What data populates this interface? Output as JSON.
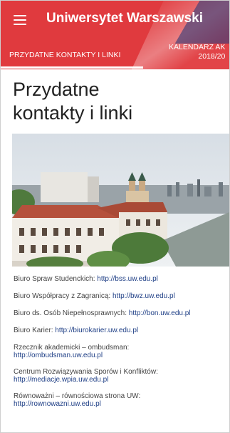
{
  "app": {
    "title": "Uniwersytet Warszawski"
  },
  "tabs": [
    {
      "label": "PRZYDATNE KONTAKTY I LINKI",
      "active": true
    },
    {
      "label_line1": "KALENDARZ AK",
      "label_line2": "2018/20",
      "active": false
    }
  ],
  "page": {
    "heading_line1": "Przydatne",
    "heading_line2": "kontakty i linki"
  },
  "links": [
    {
      "label": "Biuro Spraw Studenckich:",
      "url": "http://bss.uw.edu.pl"
    },
    {
      "label": "Biuro Współpracy z Zagranicą:",
      "url": "http://bwz.uw.edu.pl"
    },
    {
      "label": "Biuro ds. Osób Niepełnosprawnych:",
      "url": "http://bon.uw.edu.pl"
    },
    {
      "label": "Biuro Karier:",
      "url": "http://biurokarier.uw.edu.pl"
    },
    {
      "label": "Rzecznik akademicki – ombudsman:",
      "url": "http://ombudsman.uw.edu.pl"
    },
    {
      "label": "Centrum Rozwiązywania Sporów i Konfliktów:",
      "url": "http://mediacje.wpia.uw.edu.pl"
    },
    {
      "label": "Równoważni – równościowa strona UW:",
      "url": "http://rownowazni.uw.edu.pl"
    }
  ],
  "colors": {
    "appbar": "#e03a3e",
    "link": "#1f3f86",
    "text": "#444444"
  },
  "icons": {
    "menu": "hamburger-menu-icon"
  }
}
